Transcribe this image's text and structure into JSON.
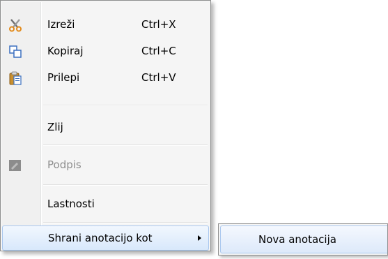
{
  "menu": {
    "items": [
      {
        "label": "Izreži",
        "shortcut": "Ctrl+X",
        "icon": "scissors-icon"
      },
      {
        "label": "Kopiraj",
        "shortcut": "Ctrl+C",
        "icon": "copy-icon"
      },
      {
        "label": "Prilepi",
        "shortcut": "Ctrl+V",
        "icon": "paste-icon"
      },
      {
        "label": "Zlij"
      },
      {
        "label": "Podpis",
        "icon": "signature-icon",
        "disabled": true
      },
      {
        "label": "Lastnosti"
      },
      {
        "label": "Shrani anotacijo kot",
        "submenu": true
      }
    ]
  },
  "submenu": {
    "items": [
      {
        "label": "Nova anotacija"
      }
    ]
  },
  "colors": {
    "highlight_border": "#a9c7ee",
    "highlight_fill": "#d8e8fb",
    "disabled_text": "#8d8d8d",
    "menu_background": "#f5f5f5"
  }
}
